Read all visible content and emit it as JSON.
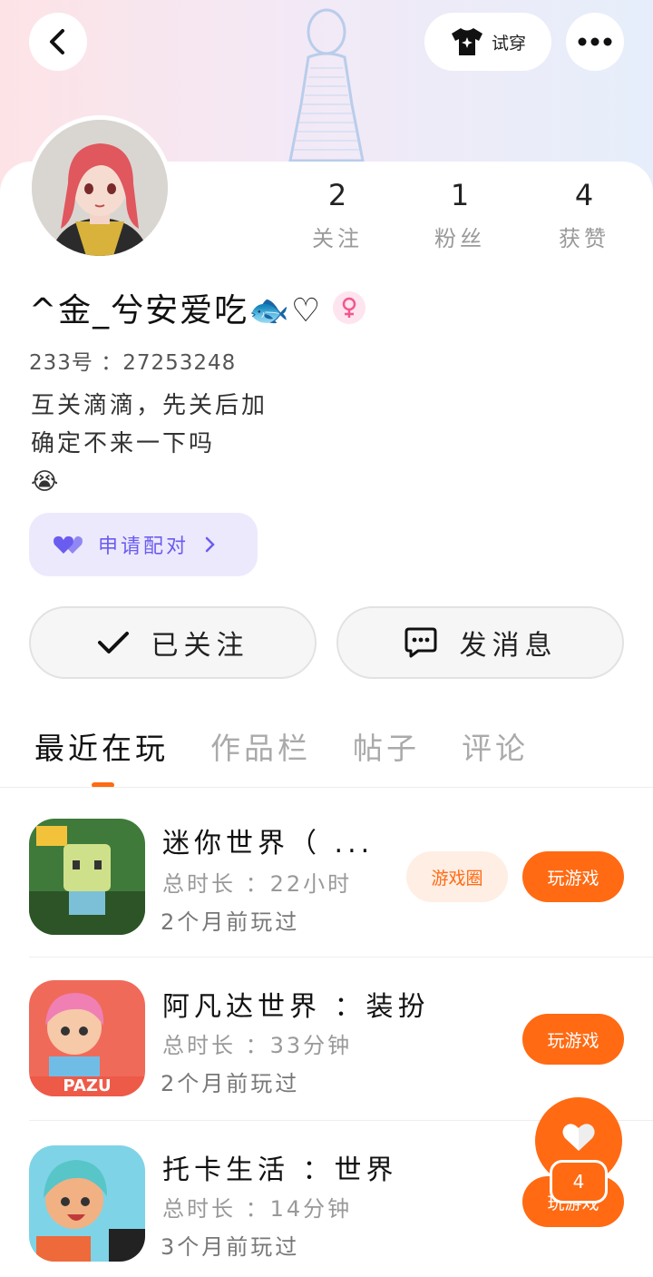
{
  "header": {
    "back_icon": "chevron-left-icon",
    "tryon_icon": "tshirt-sparkle-icon",
    "tryon_label": "试穿",
    "more_icon": "more-dots-icon"
  },
  "profile": {
    "stats": [
      {
        "value": "2",
        "label": "关注"
      },
      {
        "value": "1",
        "label": "粉丝"
      },
      {
        "value": "4",
        "label": "获赞"
      }
    ],
    "nickname": "^金_兮安爱吃🐟♡",
    "gender_icon": "female-icon",
    "id_line": "233号 ：27253248",
    "bio_line1": "互关滴滴，先关后加",
    "bio_line2": "确定不来一下吗",
    "bio_line3": "😭",
    "pair_label": "申请配对",
    "pair_icon": "double-heart-icon"
  },
  "actions": {
    "follow_label": "已关注",
    "message_label": "发消息"
  },
  "tabs": [
    "最近在玩",
    "作品栏",
    "帖子",
    "评论"
  ],
  "games": [
    {
      "name": "迷你世界（ ...",
      "time": "总时长 ：22小时",
      "last": "2个月前玩过",
      "circle": "游戏圈",
      "play": "玩游戏"
    },
    {
      "name": "阿凡达世界 ：装扮",
      "time": "总时长 ：33分钟",
      "last": "2个月前玩过",
      "play": "玩游戏"
    },
    {
      "name": "托卡生活 ：世界",
      "time": "总时长 ：14分钟",
      "last": "3个月前玩过",
      "play": "玩游戏"
    }
  ],
  "fab": {
    "icon": "heart-icon",
    "count": "4"
  },
  "colors": {
    "accent": "#ff6a13",
    "pair_bg": "#ece9fd",
    "pair_text": "#6b5cf0"
  }
}
